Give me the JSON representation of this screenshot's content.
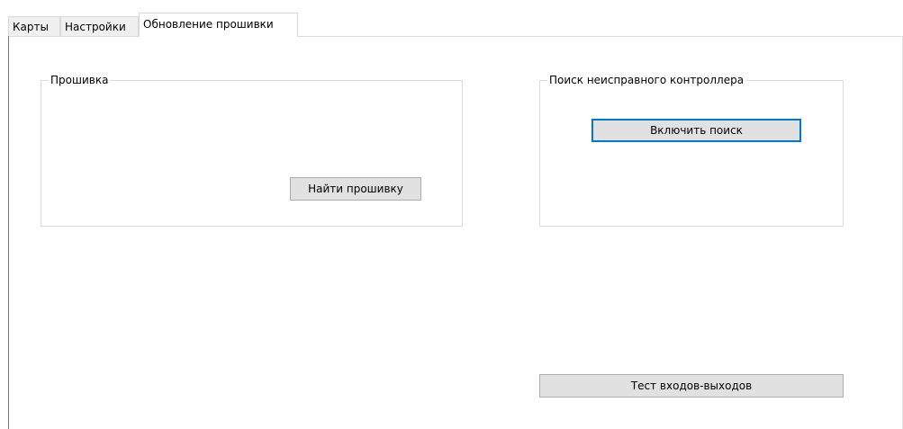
{
  "tabs": [
    {
      "label": "Карты",
      "active": false
    },
    {
      "label": "Настройки",
      "active": false
    },
    {
      "label": "Обновление прошивки",
      "active": true
    }
  ],
  "firmware_group": {
    "title": "Прошивка",
    "find_button_label": "Найти прошивку"
  },
  "search_group": {
    "title": "Поиск неисправного контроллера",
    "enable_button_label": "Включить поиск"
  },
  "io_test_button_label": "Тест входов-выходов",
  "colors": {
    "focus_border": "#0078d7",
    "button_bg": "#e1e1e1",
    "group_border": "#dcdcdc"
  }
}
